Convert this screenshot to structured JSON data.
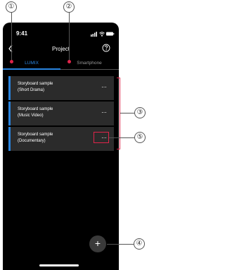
{
  "status_bar": {
    "time": "9:41"
  },
  "nav": {
    "title": "Project"
  },
  "tabs": [
    {
      "label": "LUMIX",
      "active": true
    },
    {
      "label": "Smartphone",
      "active": false
    }
  ],
  "cards": [
    {
      "line1": "Storyboard sample",
      "line2": "(Short Drama)",
      "more": "···"
    },
    {
      "line1": "Storyboard sample",
      "line2": "(Music Video)",
      "more": "···"
    },
    {
      "line1": "Storyboard sample",
      "line2": "(Documentary)",
      "more": "···"
    }
  ],
  "add_button": {
    "label": "+"
  },
  "callouts": [
    "①",
    "②",
    "③",
    "④",
    "⑤"
  ],
  "colors": {
    "accent": "#2a85e0",
    "highlight": "#e0244a",
    "background": "#000000",
    "card": "#2b2b2b"
  }
}
